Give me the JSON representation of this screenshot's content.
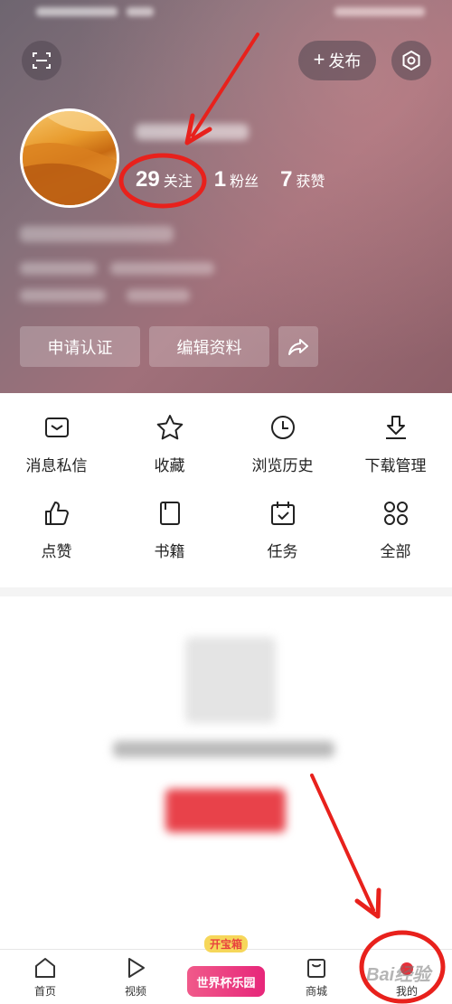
{
  "header": {
    "publish_label": "发布",
    "stats": [
      {
        "num": "29",
        "label": "关注"
      },
      {
        "num": "1",
        "label": "粉丝"
      },
      {
        "num": "7",
        "label": "获赞"
      }
    ],
    "buttons": {
      "certify": "申请认证",
      "edit_profile": "编辑资料"
    }
  },
  "grid": {
    "items": [
      {
        "label": "消息私信",
        "icon": "message-icon"
      },
      {
        "label": "收藏",
        "icon": "star-icon"
      },
      {
        "label": "浏览历史",
        "icon": "clock-icon"
      },
      {
        "label": "下载管理",
        "icon": "download-icon"
      },
      {
        "label": "点赞",
        "icon": "thumbs-up-icon"
      },
      {
        "label": "书籍",
        "icon": "book-icon"
      },
      {
        "label": "任务",
        "icon": "calendar-check-icon"
      },
      {
        "label": "全部",
        "icon": "grid-dots-icon"
      }
    ]
  },
  "bottom_nav": {
    "home": "首页",
    "video": "视频",
    "world_cup_badge": "开宝箱",
    "world_cup_card": "世界杯乐园",
    "mall": "商城",
    "me": "我的"
  },
  "watermark": "Bai经验",
  "colors": {
    "accent_red": "#e8303a",
    "annotation_red": "#e8211c",
    "header_tint": "#a0707a"
  }
}
